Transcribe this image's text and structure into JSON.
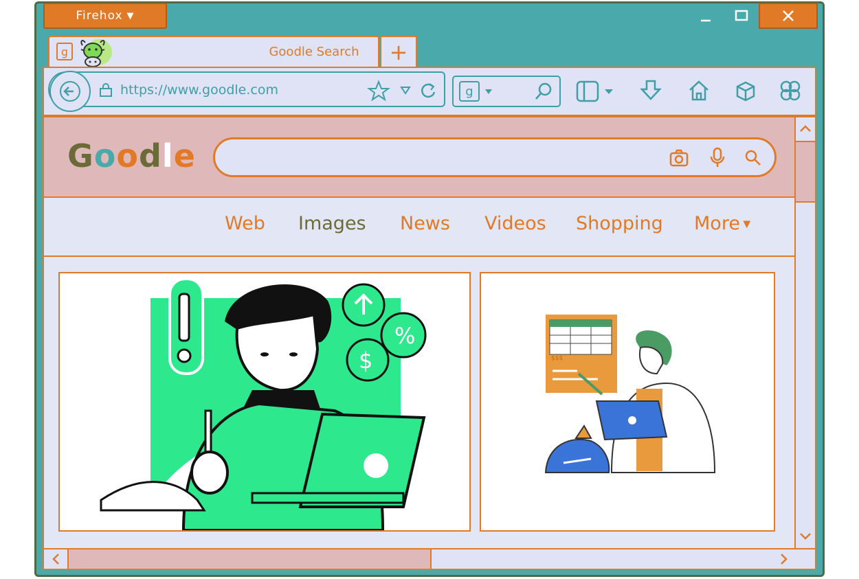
{
  "window": {
    "app_name": "Firehox"
  },
  "tabs": [
    {
      "title": "Goodle Search",
      "favicon": "g"
    }
  ],
  "new_tab_label": "+",
  "address_bar": {
    "url": "https://www.goodle.com"
  },
  "search_engine_box": {
    "engine_letter": "g"
  },
  "page": {
    "logo": {
      "letters": [
        "G",
        "o",
        "o",
        "d",
        "l",
        "e"
      ]
    },
    "search": {
      "value": ""
    },
    "nav": [
      {
        "label": "Web"
      },
      {
        "label": "Images"
      },
      {
        "label": "News"
      },
      {
        "label": "Videos"
      },
      {
        "label": "Shopping"
      },
      {
        "label": "More"
      }
    ],
    "image_cards": [
      {
        "icons": [
          "exclamation-icon",
          "arrow-up-bubble-icon",
          "percent-bubble-icon",
          "dollar-bubble-icon"
        ]
      },
      {
        "label": "$$$"
      }
    ]
  },
  "colors": {
    "frame": "#4aa9ab",
    "accent": "#e07a27",
    "panel": "#dfe3f5",
    "header": "#dfb9ba",
    "green": "#2ee88e",
    "blue": "#3b74d9"
  }
}
